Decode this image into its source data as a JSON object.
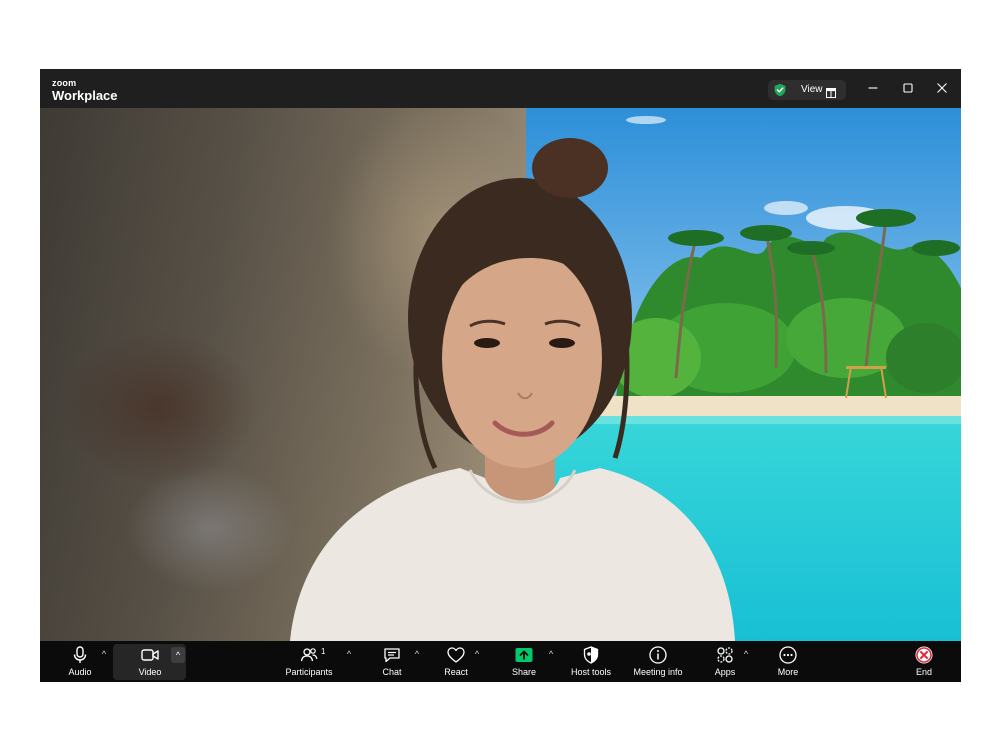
{
  "titlebar": {
    "brand_small": "zoom",
    "brand_big": "Workplace",
    "view_label": "View",
    "icons": [
      "shield-check-icon",
      "view-grid-icon",
      "minimize-icon",
      "maximize-icon",
      "close-icon"
    ]
  },
  "colors": {
    "titlebar_bg": "#1f1f1f",
    "toolbar_bg": "#0b0b0b",
    "share_green": "#00c96b",
    "end_red": "#e02c3c",
    "shield_green": "#21a65a"
  },
  "toolbar": {
    "audio": "Audio",
    "video": "Video",
    "participants": "Participants",
    "participants_count": "1",
    "chat": "Chat",
    "react": "React",
    "share": "Share",
    "host_tools": "Host tools",
    "meeting_info": "Meeting info",
    "apps": "Apps",
    "more": "More",
    "end": "End",
    "caret": "^"
  }
}
